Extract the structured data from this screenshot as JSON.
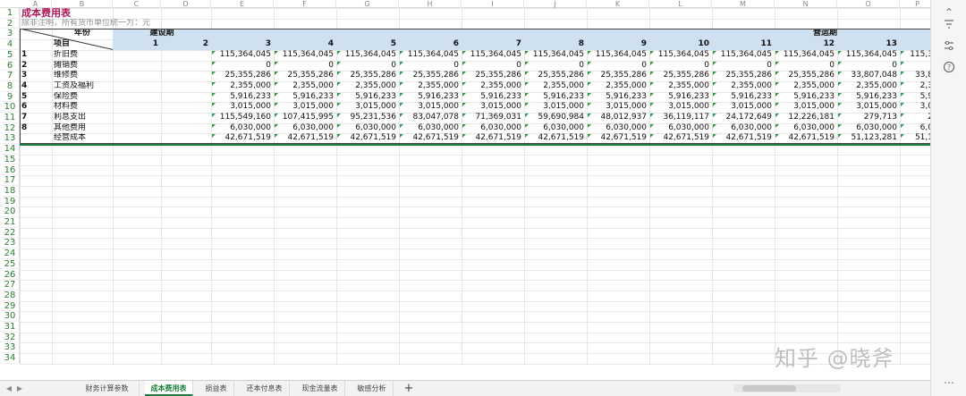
{
  "columns": [
    "A",
    "B",
    "C",
    "D",
    "E",
    "F",
    "G",
    "H",
    "I",
    "J",
    "K",
    "L",
    "M",
    "N",
    "O",
    "P"
  ],
  "rows": [
    "1",
    "2",
    "3",
    "4",
    "5",
    "6",
    "7",
    "8",
    "9",
    "10",
    "11",
    "12",
    "13",
    "14",
    "15",
    "16",
    "17",
    "18",
    "19",
    "20",
    "21",
    "22",
    "23",
    "24",
    "25",
    "26",
    "27",
    "28",
    "29",
    "30",
    "31",
    "32",
    "33",
    "34"
  ],
  "sheet": {
    "title": "成本费用表",
    "note": "除非注明，所有货币单位统一为：元",
    "header": {
      "year_label": "年份",
      "item_label": "项目",
      "construction": "建设期",
      "operation": "营运期",
      "periods": [
        "1",
        "2",
        "3",
        "4",
        "5",
        "6",
        "7",
        "8",
        "9",
        "10",
        "11",
        "12",
        "13"
      ]
    },
    "items": [
      {
        "no": "1",
        "name": "折旧费",
        "values": [
          "115,364,045",
          "115,364,045",
          "115,364,045",
          "115,364,045",
          "115,364,045",
          "115,364,045",
          "115,364,045",
          "115,364,045",
          "115,364,045",
          "115,364,045",
          "115,364,045",
          "115,3"
        ]
      },
      {
        "no": "2",
        "name": "摊销费",
        "values": [
          "0",
          "0",
          "0",
          "0",
          "0",
          "0",
          "0",
          "0",
          "0",
          "0",
          "0",
          ""
        ]
      },
      {
        "no": "3",
        "name": "维修费",
        "values": [
          "25,355,286",
          "25,355,286",
          "25,355,286",
          "25,355,286",
          "25,355,286",
          "25,355,286",
          "25,355,286",
          "25,355,286",
          "25,355,286",
          "25,355,286",
          "33,807,048",
          "33,8"
        ]
      },
      {
        "no": "4",
        "name": "工资及福利",
        "values": [
          "2,355,000",
          "2,355,000",
          "2,355,000",
          "2,355,000",
          "2,355,000",
          "2,355,000",
          "2,355,000",
          "2,355,000",
          "2,355,000",
          "2,355,000",
          "2,355,000",
          "2,3"
        ]
      },
      {
        "no": "5",
        "name": "保险费",
        "values": [
          "5,916,233",
          "5,916,233",
          "5,916,233",
          "5,916,233",
          "5,916,233",
          "5,916,233",
          "5,916,233",
          "5,916,233",
          "5,916,233",
          "5,916,233",
          "5,916,233",
          "5,9"
        ]
      },
      {
        "no": "6",
        "name": "材料费",
        "values": [
          "3,015,000",
          "3,015,000",
          "3,015,000",
          "3,015,000",
          "3,015,000",
          "3,015,000",
          "3,015,000",
          "3,015,000",
          "3,015,000",
          "3,015,000",
          "3,015,000",
          "3,0"
        ]
      },
      {
        "no": "7",
        "name": "利息支出",
        "values": [
          "115,549,160",
          "107,415,995",
          "95,231,536",
          "83,047,078",
          "71,369,031",
          "59,690,984",
          "48,012,937",
          "36,119,117",
          "24,172,649",
          "12,226,181",
          "279,713",
          "2"
        ]
      },
      {
        "no": "8",
        "name": "其他费用",
        "values": [
          "6,030,000",
          "6,030,000",
          "6,030,000",
          "6,030,000",
          "6,030,000",
          "6,030,000",
          "6,030,000",
          "6,030,000",
          "6,030,000",
          "6,030,000",
          "6,030,000",
          "6,0"
        ]
      },
      {
        "no": "",
        "name": "经营成本",
        "values": [
          "42,671,519",
          "42,671,519",
          "42,671,519",
          "42,671,519",
          "42,671,519",
          "42,671,519",
          "42,671,519",
          "42,671,519",
          "42,671,519",
          "42,671,519",
          "51,123,281",
          "51,1"
        ]
      }
    ]
  },
  "tabs": [
    {
      "label": "财务计算参数",
      "active": false
    },
    {
      "label": "成本费用表",
      "active": true
    },
    {
      "label": "损益表",
      "active": false
    },
    {
      "label": "还本付息表",
      "active": false
    },
    {
      "label": "现金流量表",
      "active": false
    },
    {
      "label": "敏感分析",
      "active": false
    }
  ],
  "add_tab": "+",
  "watermark": "知乎 @晓斧",
  "icons": {
    "scroll_up": "chevron-up-icon",
    "filter": "filter-icon",
    "sliders": "sliders-icon",
    "help": "help-icon",
    "more": "more-icon"
  },
  "colors": {
    "accent_green": "#1a7f3a",
    "header_fill": "#cfe0f1",
    "title": "#b0185a"
  }
}
